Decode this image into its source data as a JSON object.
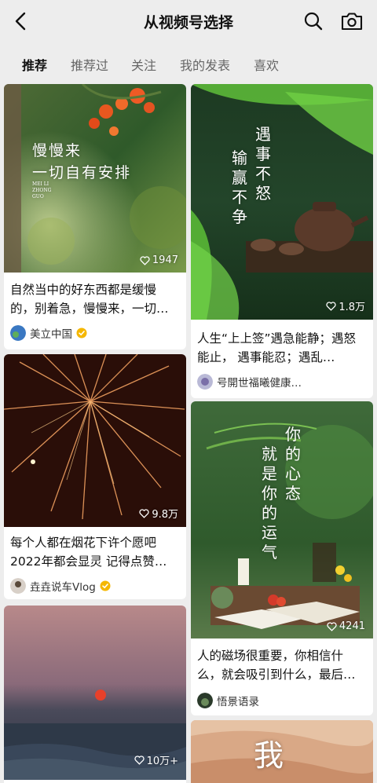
{
  "header": {
    "title": "从视频号选择"
  },
  "tabs": [
    {
      "label": "推荐",
      "active": true
    },
    {
      "label": "推荐过",
      "active": false
    },
    {
      "label": "关注",
      "active": false
    },
    {
      "label": "我的发表",
      "active": false
    },
    {
      "label": "喜欢",
      "active": false
    }
  ],
  "cards": [
    {
      "overlay_line1": "慢慢来",
      "overlay_line2": "一切自有安排",
      "overlay_small": "MEI LI ZHONG GUO",
      "likes": "1947",
      "caption": "自然当中的好东西都是缓慢的，别着急，慢慢来，一切…",
      "author": "美立中国",
      "verified": true
    },
    {
      "overlay_col1": "遇事不怒",
      "overlay_col2": "输赢不争",
      "likes": "1.8万",
      "caption": "人生“上上签”遇急能静；遇怒能止， 遇事能忍；遇乱…",
      "author": "号開世福曦健康…",
      "verified": false
    },
    {
      "likes": "9.8万",
      "caption": "每个人都在烟花下许个愿吧2022年都会显灵 记得点赞…",
      "author": "垚垚说车Vlog",
      "verified": true
    },
    {
      "overlay_col1": "你的心态",
      "overlay_col2": "就是你的运气",
      "likes": "4241",
      "caption": "人的磁场很重要，你相信什么，就会吸引到什么，最后…",
      "author": "悟景语录",
      "verified": false
    },
    {
      "likes": "10万+"
    },
    {
      "overlay_text": "我"
    }
  ],
  "colors": {
    "background": "#ededed",
    "card": "#ffffff",
    "verified": "#f5b700"
  }
}
